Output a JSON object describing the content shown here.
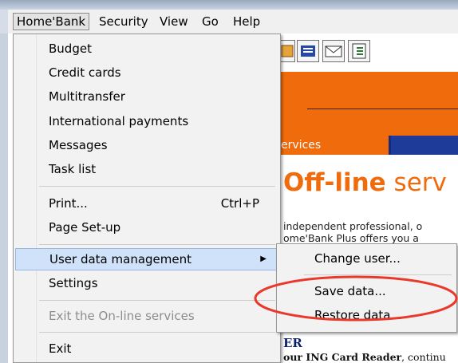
{
  "menubar": {
    "items": [
      "Home'Bank",
      "Security",
      "View",
      "Go",
      "Help"
    ]
  },
  "homebank_menu": {
    "items": [
      {
        "label": "Budget"
      },
      {
        "label": "Credit cards"
      },
      {
        "label": "Multitransfer"
      },
      {
        "label": "International payments"
      },
      {
        "label": "Messages"
      },
      {
        "label": "Task list"
      },
      {
        "label": "Print...",
        "shortcut": "Ctrl+P"
      },
      {
        "label": "Page Set-up"
      },
      {
        "label": "User data management",
        "submenu_arrow": "▶"
      },
      {
        "label": "Settings"
      },
      {
        "label": "Exit the On-line services",
        "disabled": true
      },
      {
        "label": "Exit"
      }
    ]
  },
  "submenu": {
    "items": [
      "Change user...",
      "Save data...",
      "Restore data..."
    ]
  },
  "background": {
    "nav_tab": "ervices",
    "title_bold": "Off-line",
    "title_light": " serv",
    "para_1": "independent professional, o",
    "para_2": "ome'Bank Plus offers you a",
    "heading": "ER",
    "card_line_bold": "our ING Card Reader",
    "card_line_rest": ", continu"
  },
  "annotation": {
    "color": "#e8392a"
  },
  "colors": {
    "accent_orange": "#f06b0c",
    "nav_blue": "#1a2a7a",
    "highlight": "#cfe2f9"
  }
}
